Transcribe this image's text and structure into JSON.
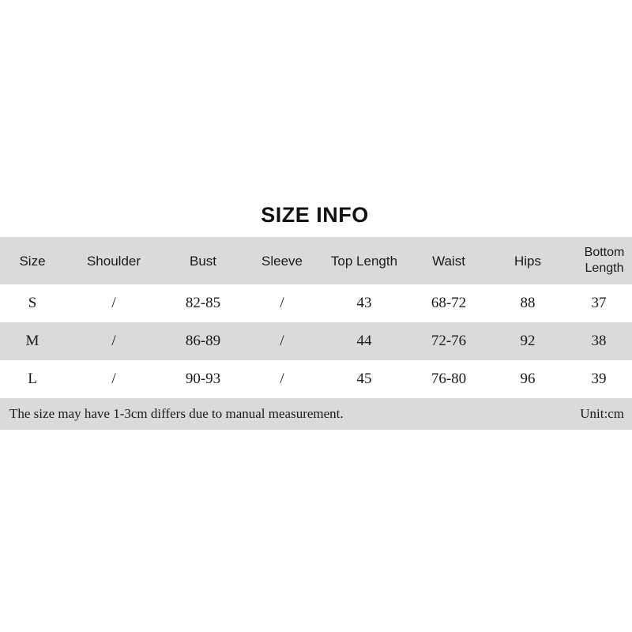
{
  "chart_data": {
    "type": "table",
    "title": "SIZE INFO",
    "columns": [
      "Size",
      "Shoulder",
      "Bust",
      "Sleeve",
      "Top Length",
      "Waist",
      "Hips",
      "Bottom Length"
    ],
    "rows": [
      [
        "S",
        "/",
        "82-85",
        "/",
        "43",
        "68-72",
        "88",
        "37"
      ],
      [
        "M",
        "/",
        "86-89",
        "/",
        "44",
        "72-76",
        "92",
        "38"
      ],
      [
        "L",
        "/",
        "90-93",
        "/",
        "45",
        "76-80",
        "96",
        "39"
      ]
    ],
    "footnote": "The size may have 1-3cm differs due to manual measurement.",
    "unit_label": "Unit:cm",
    "header_background": "#dadada",
    "alt_row_background": "#dadada",
    "row_background": "#ffffff",
    "text_color": "#1a1a1a",
    "page_background": "#ffffff"
  },
  "table": {
    "title": "SIZE INFO",
    "headers": {
      "size": "Size",
      "shoulder": "Shoulder",
      "bust": "Bust",
      "sleeve": "Sleeve",
      "top_length": "Top Length",
      "waist": "Waist",
      "hips": "Hips",
      "bottom_length": "Bottom Length"
    },
    "rows": [
      {
        "size": "S",
        "shoulder": "/",
        "bust": "82-85",
        "sleeve": "/",
        "top_length": "43",
        "waist": "68-72",
        "hips": "88",
        "bottom_length": "37"
      },
      {
        "size": "M",
        "shoulder": "/",
        "bust": "86-89",
        "sleeve": "/",
        "top_length": "44",
        "waist": "72-76",
        "hips": "92",
        "bottom_length": "38"
      },
      {
        "size": "L",
        "shoulder": "/",
        "bust": "90-93",
        "sleeve": "/",
        "top_length": "45",
        "waist": "76-80",
        "hips": "96",
        "bottom_length": "39"
      }
    ],
    "footnote": "The size may have 1-3cm differs due to manual measurement.",
    "unit_label": "Unit:cm"
  }
}
